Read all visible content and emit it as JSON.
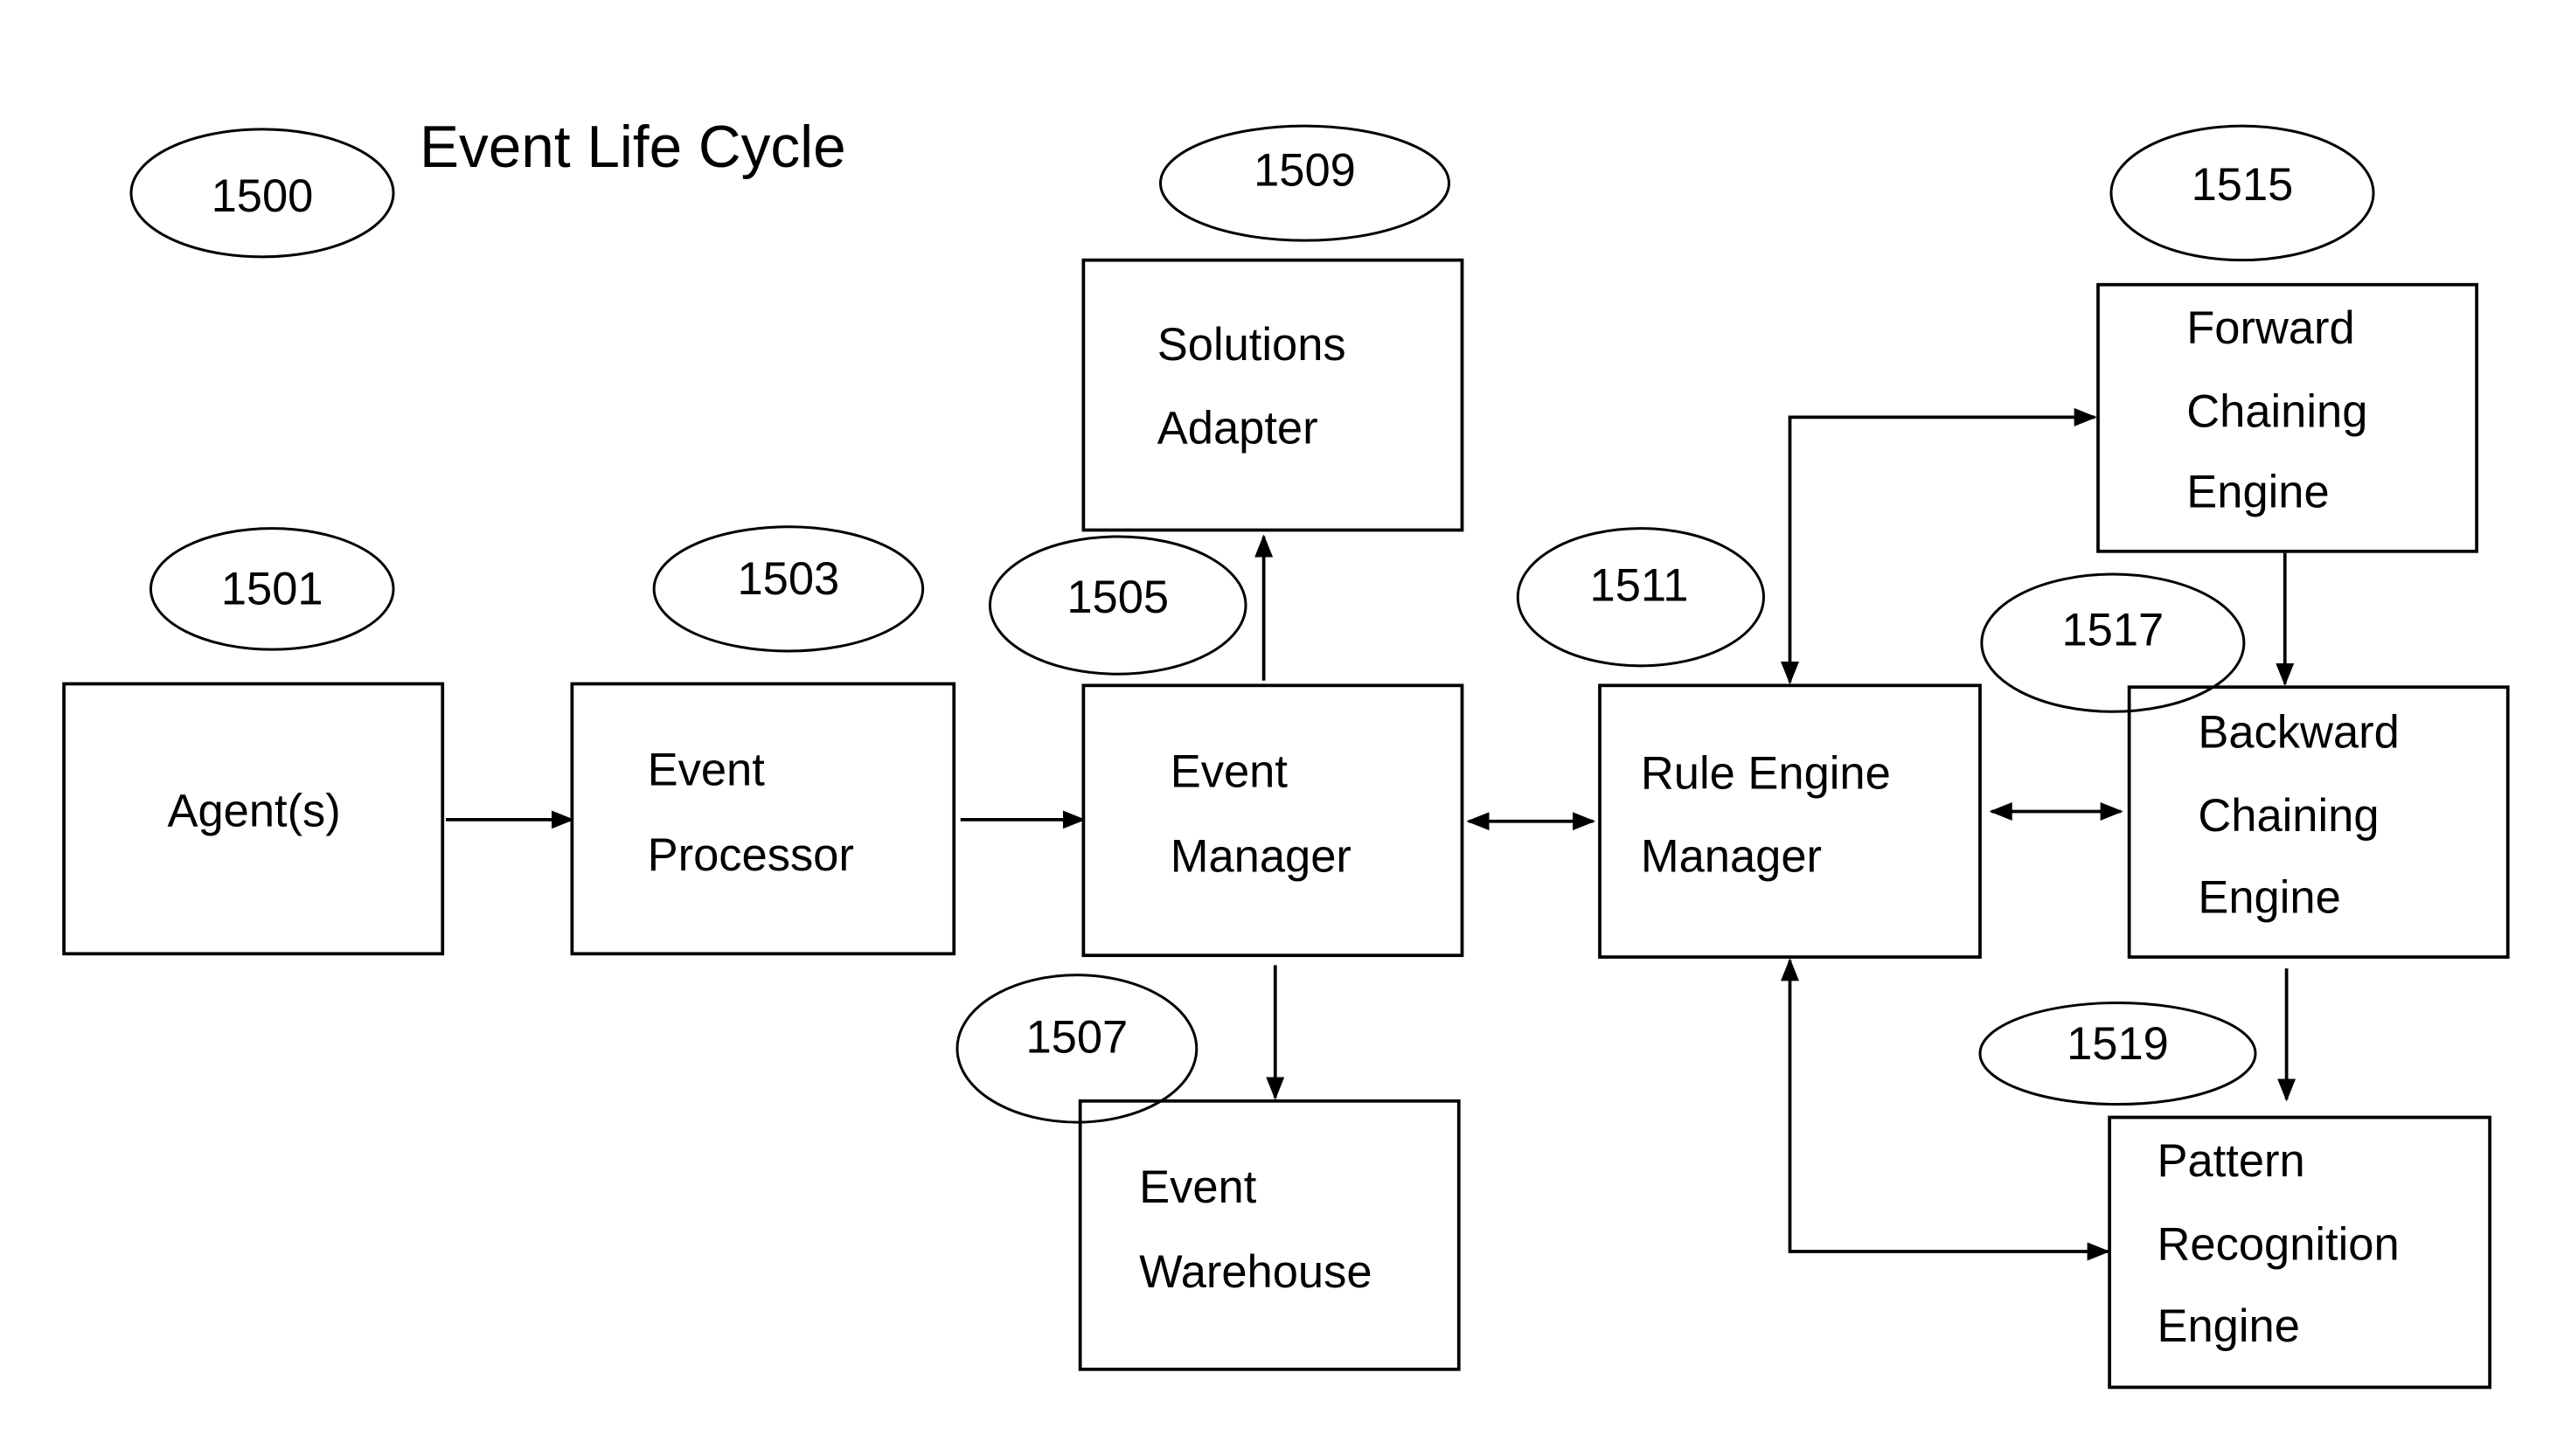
{
  "title": "Event Life Cycle",
  "figure_ref": "1500",
  "colors": {
    "stroke": "#000000",
    "background": "#ffffff"
  },
  "nodes": [
    {
      "id": "agents",
      "ref": "1501",
      "lines": [
        "Agent(s)"
      ]
    },
    {
      "id": "event-processor",
      "ref": "1503",
      "lines": [
        "Event",
        "Processor"
      ]
    },
    {
      "id": "event-manager",
      "ref": "1505",
      "lines": [
        "Event",
        "Manager"
      ]
    },
    {
      "id": "event-warehouse",
      "ref": "1507",
      "lines": [
        "Event",
        "Warehouse"
      ]
    },
    {
      "id": "solutions-adapter",
      "ref": "1509",
      "lines": [
        "Solutions",
        "Adapter"
      ]
    },
    {
      "id": "rule-engine-manager",
      "ref": "1511",
      "lines": [
        "Rule Engine",
        "Manager"
      ]
    },
    {
      "id": "forward-chaining-engine",
      "ref": "1515",
      "lines": [
        "Forward",
        "Chaining",
        "Engine"
      ]
    },
    {
      "id": "backward-chaining-engine",
      "ref": "1517",
      "lines": [
        "Backward",
        "Chaining",
        "Engine"
      ]
    },
    {
      "id": "pattern-recognition-engine",
      "ref": "1519",
      "lines": [
        "Pattern",
        "Recognition",
        "Engine"
      ]
    }
  ],
  "edges": [
    {
      "from": "agents",
      "to": "event-processor",
      "direction": "forward"
    },
    {
      "from": "event-processor",
      "to": "event-manager",
      "direction": "forward"
    },
    {
      "from": "event-manager",
      "to": "solutions-adapter",
      "direction": "forward"
    },
    {
      "from": "event-manager",
      "to": "event-warehouse",
      "direction": "forward"
    },
    {
      "from": "event-manager",
      "to": "rule-engine-manager",
      "direction": "both"
    },
    {
      "from": "rule-engine-manager",
      "to": "forward-chaining-engine",
      "direction": "both"
    },
    {
      "from": "rule-engine-manager",
      "to": "backward-chaining-engine",
      "direction": "both"
    },
    {
      "from": "rule-engine-manager",
      "to": "pattern-recognition-engine",
      "direction": "both"
    },
    {
      "from": "forward-chaining-engine",
      "to": "backward-chaining-engine",
      "direction": "forward"
    },
    {
      "from": "backward-chaining-engine",
      "to": "pattern-recognition-engine",
      "direction": "forward"
    }
  ]
}
